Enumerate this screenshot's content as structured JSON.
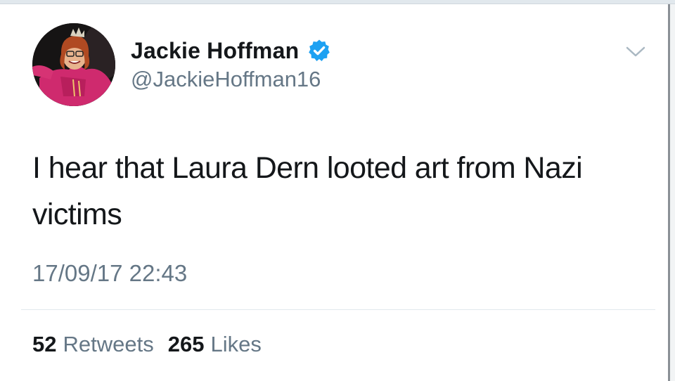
{
  "tweet": {
    "author": {
      "display_name": "Jackie Hoffman",
      "handle": "@JackieHoffman16",
      "verified": true,
      "avatar_icon": "profile-photo"
    },
    "text": "I hear that Laura Dern looted art from Nazi victims",
    "timestamp": "17/09/17 22:43",
    "stats": {
      "retweets_count": "52",
      "retweets_label": "Retweets",
      "likes_count": "265",
      "likes_label": "Likes"
    },
    "menu_icon": "chevron-down-icon"
  },
  "colors": {
    "text_primary": "#14171a",
    "text_secondary": "#657786",
    "verified_blue": "#1da1f2",
    "divider": "#e1e8ed"
  }
}
